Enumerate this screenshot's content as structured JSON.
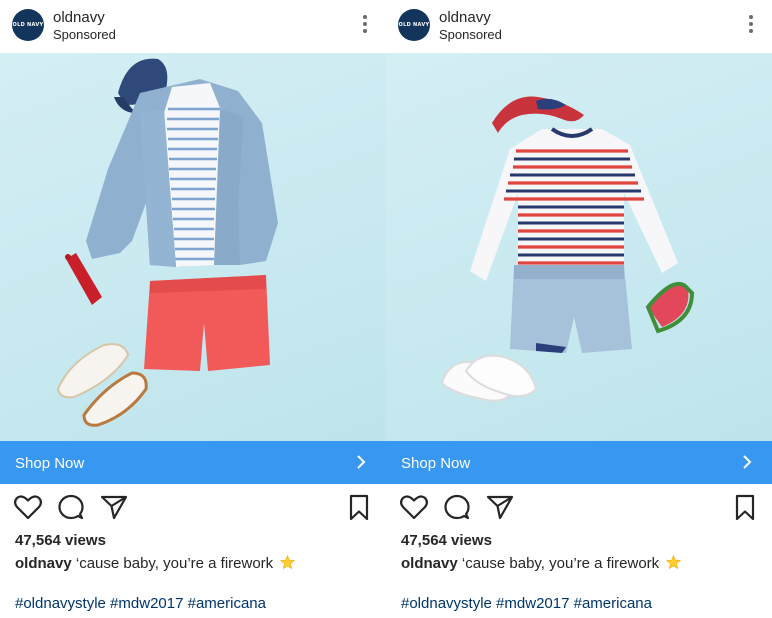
{
  "colors": {
    "brand_avatar": "#13355c",
    "cta_blue": "#3897f0",
    "hashtag_blue": "#003569",
    "photo_bg": "#c8e9f0"
  },
  "posts": [
    {
      "avatar_text": "OLD NAVY",
      "username": "oldnavy",
      "sponsored": "Sponsored",
      "cta_label": "Shop Now",
      "views": "47,564 views",
      "caption_user": "oldnavy",
      "caption_text": "‘cause baby, you’re a firework",
      "hashtags": "#oldnavystyle #mdw2017 #americana",
      "icons": [
        "more-options-icon",
        "heart-icon",
        "comment-icon",
        "share-icon",
        "bookmark-icon",
        "chevron-right-icon",
        "star-icon"
      ]
    },
    {
      "avatar_text": "OLD NAVY",
      "username": "oldnavy",
      "sponsored": "Sponsored",
      "cta_label": "Shop Now",
      "views": "47,564 views",
      "caption_user": "oldnavy",
      "caption_text": "‘cause baby, you’re a firework",
      "hashtags": "#oldnavystyle #mdw2017 #americana",
      "icons": [
        "more-options-icon",
        "heart-icon",
        "comment-icon",
        "share-icon",
        "bookmark-icon",
        "chevron-right-icon",
        "star-icon"
      ]
    }
  ]
}
